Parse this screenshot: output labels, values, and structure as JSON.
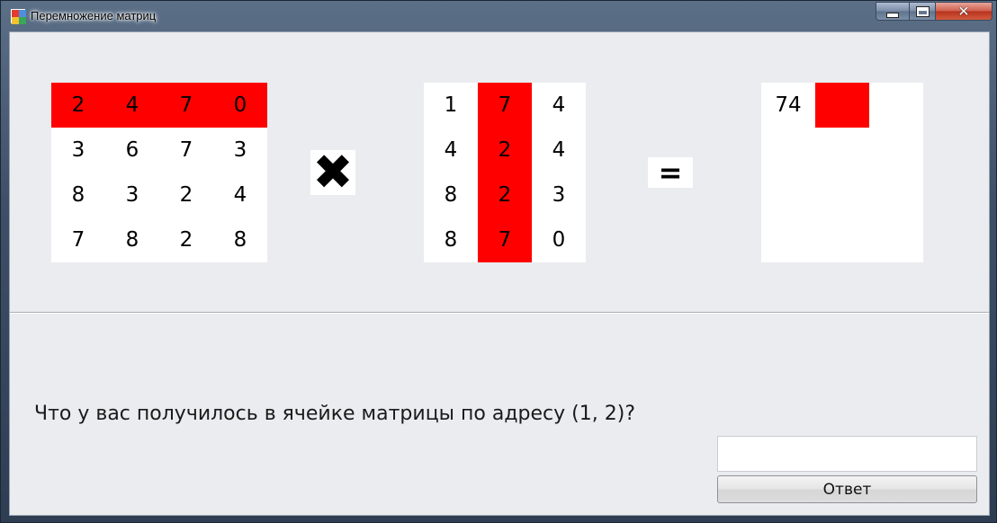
{
  "window": {
    "title": "Перемножение матриц",
    "controls": {
      "minimize": "minimize-icon",
      "maximize": "maximize-icon",
      "close": "close-icon"
    },
    "close_glyph": "✕"
  },
  "matrix_a": {
    "rows": [
      [
        "2",
        "4",
        "7",
        "0"
      ],
      [
        "3",
        "6",
        "7",
        "3"
      ],
      [
        "8",
        "3",
        "2",
        "4"
      ],
      [
        "7",
        "8",
        "2",
        "8"
      ]
    ],
    "highlight_row": 0,
    "highlight_color": "#ff0000"
  },
  "operator_times": "✖",
  "matrix_b": {
    "rows": [
      [
        "1",
        "7",
        "4"
      ],
      [
        "4",
        "2",
        "4"
      ],
      [
        "8",
        "2",
        "3"
      ],
      [
        "8",
        "7",
        "0"
      ]
    ],
    "highlight_col": 1,
    "highlight_color": "#ff0000"
  },
  "operator_equals": "=",
  "matrix_result": {
    "values": [
      [
        "74",
        ""
      ]
    ],
    "highlight_cell": [
      0,
      1
    ],
    "highlight_color": "#ff0000"
  },
  "question": "Что у вас получилось в ячейке матрицы по адресу (1, 2)?",
  "answer": {
    "value": "",
    "placeholder": ""
  },
  "submit_label": "Ответ"
}
